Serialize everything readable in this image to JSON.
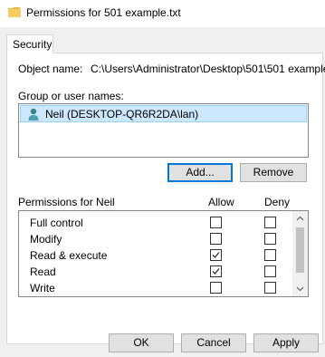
{
  "window": {
    "title": "Permissions for 501 example.txt",
    "icon": "folder-icon"
  },
  "tabs": [
    {
      "label": "Security",
      "active": true
    }
  ],
  "security": {
    "object_name_label": "Object name:",
    "object_name_value": "C:\\Users\\Administrator\\Desktop\\501\\501 example",
    "group_label": "Group or user names:",
    "users": [
      {
        "name": "Neil (DESKTOP-QR6R2DA\\lan)",
        "icon": "user-icon",
        "selected": true
      }
    ],
    "add_label": "Add...",
    "remove_label": "Remove",
    "permissions_for_label": "Permissions for Neil",
    "allow_header": "Allow",
    "deny_header": "Deny",
    "permissions": [
      {
        "name": "Full control",
        "allow": false,
        "deny": false
      },
      {
        "name": "Modify",
        "allow": false,
        "deny": false
      },
      {
        "name": "Read & execute",
        "allow": true,
        "deny": false
      },
      {
        "name": "Read",
        "allow": true,
        "deny": false
      },
      {
        "name": "Write",
        "allow": false,
        "deny": false
      }
    ]
  },
  "footer": {
    "ok_label": "OK",
    "cancel_label": "Cancel",
    "apply_label": "Apply"
  }
}
